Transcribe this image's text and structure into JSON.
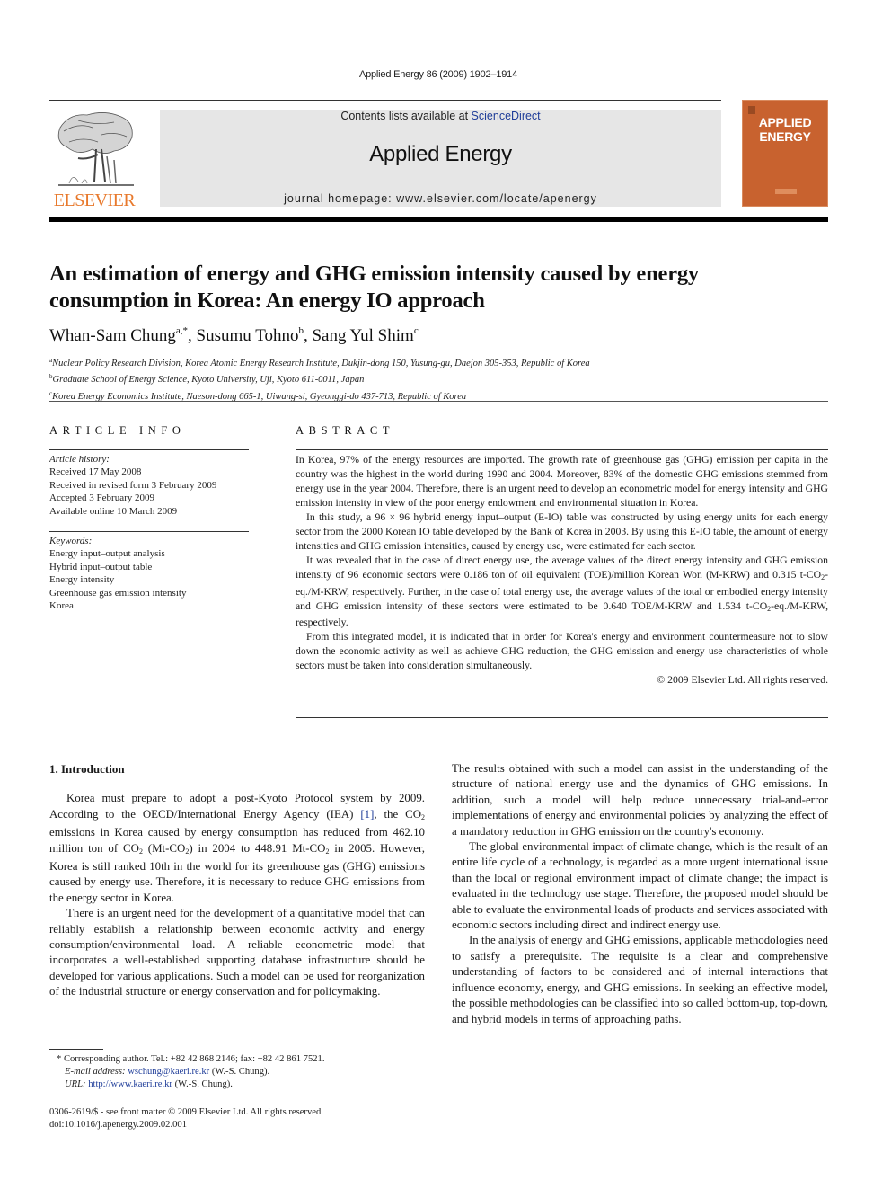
{
  "header": {
    "journal_reference": "Applied Energy 86 (2009) 1902–1914",
    "contents_prefix": "Contents lists available at ",
    "contents_link": "ScienceDirect",
    "journal_name": "Applied Energy",
    "homepage": "journal homepage: www.elsevier.com/locate/apenergy",
    "publisher_logo_text": "ELSEVIER",
    "cover_title_line1": "APPLIED",
    "cover_title_line2": "ENERGY",
    "colors": {
      "publisher_orange": "#e8792c",
      "cover_orange": "#c8622f",
      "link_blue": "#1f3d99",
      "masthead_gray": "#e6e6e6"
    }
  },
  "article": {
    "title": "An estimation of energy and GHG emission intensity caused by energy consumption in Korea: An energy IO approach",
    "authors": [
      {
        "name": "Whan-Sam Chung",
        "sup": "a,*",
        "sep": ", "
      },
      {
        "name": "Susumu Tohno",
        "sup": "b",
        "sep": ", "
      },
      {
        "name": "Sang Yul Shim",
        "sup": "c",
        "sep": ""
      }
    ],
    "affiliations": [
      {
        "mark": "a",
        "text": "Nuclear Policy Research Division, Korea Atomic Energy Research Institute, Dukjin-dong 150, Yusung-gu, Daejon 305-353, Republic of Korea"
      },
      {
        "mark": "b",
        "text": "Graduate School of Energy Science, Kyoto University, Uji, Kyoto 611-0011, Japan"
      },
      {
        "mark": "c",
        "text": "Korea Energy Economics Institute, Naeson-dong 665-1, Uiwang-si, Gyeonggi-do 437-713, Republic of Korea"
      }
    ]
  },
  "article_info": {
    "heading": "ARTICLE INFO",
    "history_label": "Article history:",
    "history": [
      "Received 17 May 2008",
      "Received in revised form 3 February 2009",
      "Accepted 3 February 2009",
      "Available online 10 March 2009"
    ],
    "keywords_label": "Keywords:",
    "keywords": [
      "Energy input–output analysis",
      "Hybrid input–output table",
      "Energy intensity",
      "Greenhouse gas emission intensity",
      "Korea"
    ]
  },
  "abstract": {
    "heading": "ABSTRACT",
    "p1": "In Korea, 97% of the energy resources are imported. The growth rate of greenhouse gas (GHG) emission per capita in the country was the highest in the world during 1990 and 2004. Moreover, 83% of the domestic GHG emissions stemmed from energy use in the year 2004. Therefore, there is an urgent need to develop an econometric model for energy intensity and GHG emission intensity in view of the poor energy endowment and environmental situation in Korea.",
    "p2": "In this study, a 96 × 96 hybrid energy input–output (E-IO) table was constructed by using energy units for each energy sector from the 2000 Korean IO table developed by the Bank of Korea in 2003. By using this E-IO table, the amount of energy intensities and GHG emission intensities, caused by energy use, were estimated for each sector.",
    "p3_a": "It was revealed that in the case of direct energy use, the average values of the direct energy intensity and GHG emission intensity of 96 economic sectors were 0.186 ton of oil equivalent (TOE)/million Korean Won (M-KRW) and 0.315 t-CO",
    "p3_b": "-eq./M-KRW, respectively. Further, in the case of total energy use, the average values of the total or embodied energy intensity and GHG emission intensity of these sectors were estimated to be 0.640 TOE/M-KRW and 1.534 t-CO",
    "p3_c": "-eq./M-KRW, respectively.",
    "p4": "From this integrated model, it is indicated that in order for Korea's energy and environment countermeasure not to slow down the economic activity as well as achieve GHG reduction, the GHG emission and energy use characteristics of whole sectors must be taken into consideration simultaneously.",
    "copyright": "© 2009 Elsevier Ltd. All rights reserved.",
    "sub2": "2"
  },
  "introduction": {
    "heading": "1. Introduction",
    "p1_a": "Korea must prepare to adopt a post-Kyoto Protocol system by 2009. According to the OECD/International Energy Agency (IEA) ",
    "p1_cite": "[1]",
    "p1_b": ", the CO",
    "p1_c": " emissions in Korea caused by energy consumption has reduced from 462.10 million ton of CO",
    "p1_d": " (Mt-CO",
    "p1_e": ") in 2004 to 448.91 Mt-CO",
    "p1_f": " in 2005. However, Korea is still ranked 10th in the world for its greenhouse gas (GHG) emissions caused by energy use. Therefore, it is necessary to reduce GHG emissions from the energy sector in Korea.",
    "p2": "There is an urgent need for the development of a quantitative model that can reliably establish a relationship between economic activity and energy consumption/environmental load. A reliable econometric model that incorporates a well-established supporting database infrastructure should be developed for various applications. Such a model can be used for reorganization of the industrial structure or energy conservation and for policymaking.",
    "p3": "The results obtained with such a model can assist in the understanding of the structure of national energy use and the dynamics of GHG emissions. In addition, such a model will help reduce unnecessary trial-and-error implementations of energy and environmental policies by analyzing the effect of a mandatory reduction in GHG emission on the country's economy.",
    "p4": "The global environmental impact of climate change, which is the result of an entire life cycle of a technology, is regarded as a more urgent international issue than the local or regional environment impact of climate change; the impact is evaluated in the technology use stage. Therefore, the proposed model should be able to evaluate the environmental loads of products and services associated with economic sectors including direct and indirect energy use.",
    "p5": "In the analysis of energy and GHG emissions, applicable methodologies need to satisfy a prerequisite. The requisite is a clear and comprehensive understanding of factors to be considered and of internal interactions that influence economy, energy, and GHG emissions. In seeking an effective model, the possible methodologies can be classified into so called bottom-up, top-down, and hybrid models in terms of approaching paths."
  },
  "footnotes": {
    "corresponding": "*  Corresponding author. Tel.: +82 42 868 2146; fax: +82 42 861 7521.",
    "email_label": "E-mail address: ",
    "email": "wschung@kaeri.re.kr",
    "email_suffix": " (W.-S. Chung).",
    "url_label": "URL: ",
    "url": "http://www.kaeri.re.kr",
    "url_suffix": " (W.-S. Chung)."
  },
  "front_matter": {
    "issn_line": "0306-2619/$ - see front matter © 2009 Elsevier Ltd. All rights reserved.",
    "doi": "doi:10.1016/j.apenergy.2009.02.001"
  }
}
